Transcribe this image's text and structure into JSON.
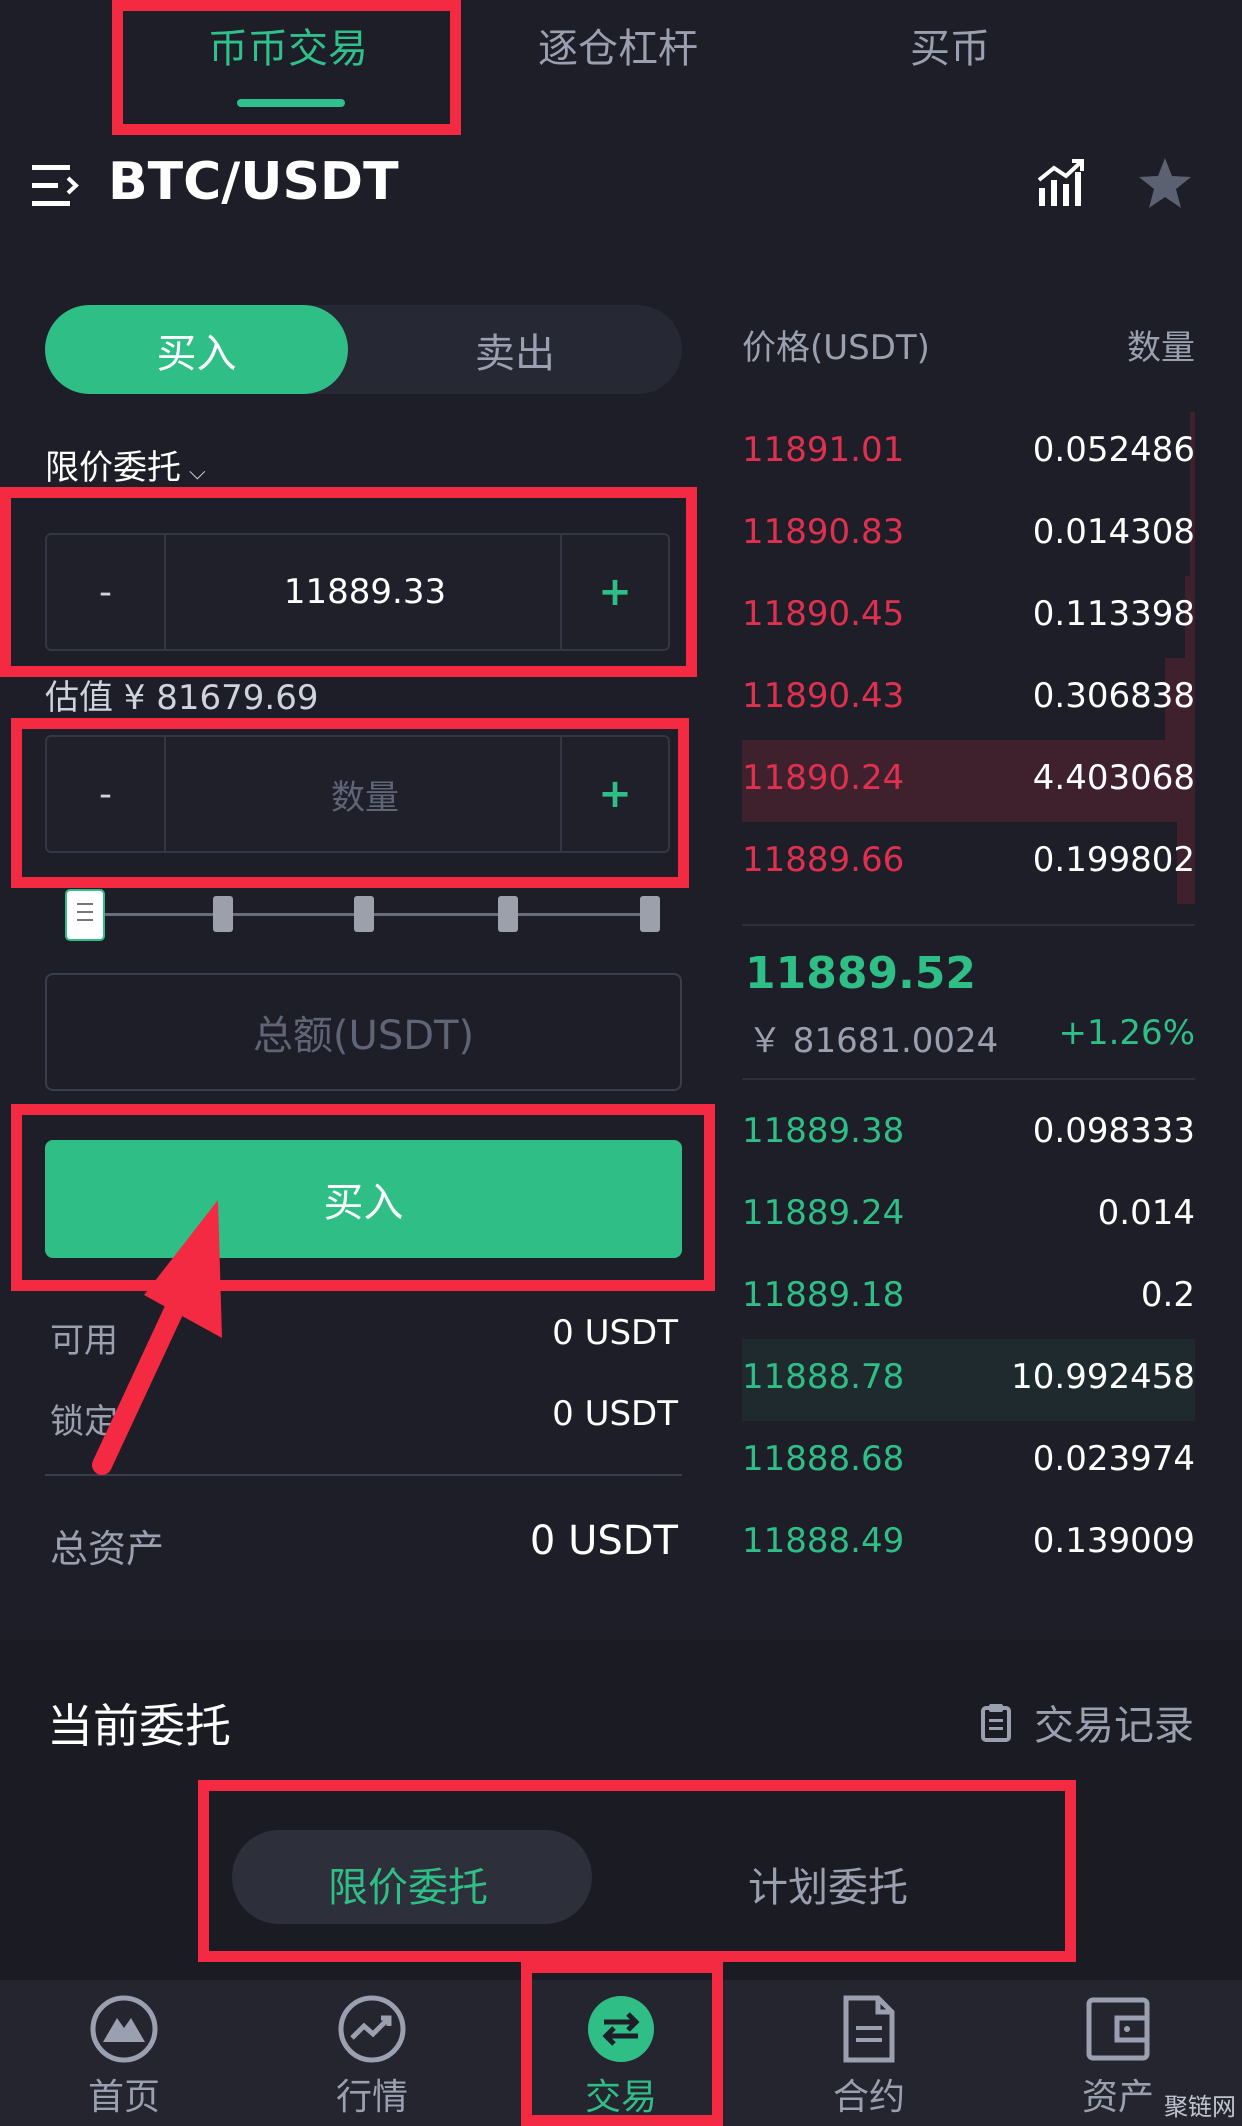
{
  "top_tabs": [
    {
      "label": "币币交易",
      "active": true
    },
    {
      "label": "逐仓杠杆",
      "active": false
    },
    {
      "label": "买币",
      "active": false
    }
  ],
  "header": {
    "pair": "BTC/USDT",
    "menu_icon": "menu-icon",
    "chart_icon": "chart-icon",
    "star_icon": "star-icon"
  },
  "trade_form": {
    "buy_tab": "买入",
    "sell_tab": "卖出",
    "order_type": "限价委托",
    "price_minus": "-",
    "price_value": "11889.33",
    "price_plus": "+",
    "estimate": "估值 ¥ 81679.69",
    "amount_minus": "-",
    "amount_placeholder": "数量",
    "amount_plus": "+",
    "slider_value": 0,
    "total_placeholder": "总额(USDT)",
    "buy_button": "买入"
  },
  "balances": {
    "available_label": "可用",
    "available_value": "0 USDT",
    "locked_label": "锁定",
    "locked_value": "0 USDT",
    "total_label": "总资产",
    "total_value": "0 USDT"
  },
  "order_book": {
    "price_header": "价格(USDT)",
    "qty_header": "数量",
    "asks": [
      {
        "price": "11891.01",
        "qty": "0.052486"
      },
      {
        "price": "11890.83",
        "qty": "0.014308"
      },
      {
        "price": "11890.45",
        "qty": "0.113398"
      },
      {
        "price": "11890.43",
        "qty": "0.306838"
      },
      {
        "price": "11890.24",
        "qty": "4.403068"
      },
      {
        "price": "11889.66",
        "qty": "0.199802"
      }
    ],
    "last_price": "11889.52",
    "fiat_price": "￥ 81681.0024",
    "change": "+1.26%",
    "bids": [
      {
        "price": "11889.38",
        "qty": "0.098333"
      },
      {
        "price": "11889.24",
        "qty": "0.014"
      },
      {
        "price": "11889.18",
        "qty": "0.2"
      },
      {
        "price": "11888.78",
        "qty": "10.992458"
      },
      {
        "price": "11888.68",
        "qty": "0.023974"
      },
      {
        "price": "11888.49",
        "qty": "0.139009"
      }
    ]
  },
  "orders": {
    "title": "当前委托",
    "records_link": "交易记录",
    "tabs": [
      {
        "label": "限价委托",
        "active": true
      },
      {
        "label": "计划委托",
        "active": false
      }
    ]
  },
  "bottom_nav": [
    {
      "label": "首页",
      "icon": "home-icon",
      "active": false
    },
    {
      "label": "行情",
      "icon": "market-icon",
      "active": false
    },
    {
      "label": "交易",
      "icon": "trade-icon",
      "active": true
    },
    {
      "label": "合约",
      "icon": "contract-icon",
      "active": false
    },
    {
      "label": "资产",
      "icon": "wallet-icon",
      "active": false
    }
  ],
  "watermark": "聚链网",
  "colors": {
    "background": "#1d1e27",
    "accent_green": "#2fbf86",
    "ask_red": "#e0304f",
    "annotation_red": "#f32a41"
  }
}
